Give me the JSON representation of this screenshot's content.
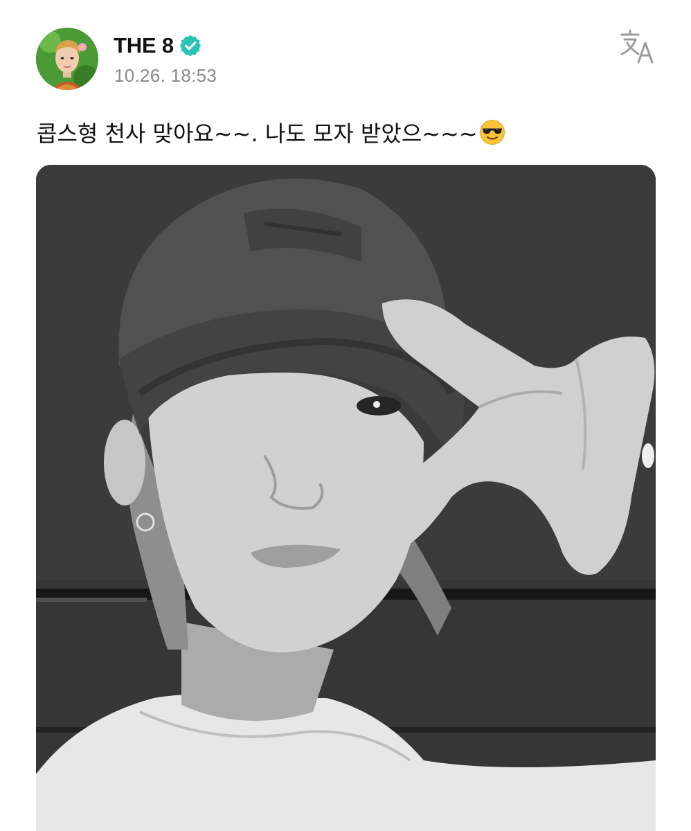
{
  "author": {
    "name": "THE 8",
    "verified": true,
    "avatar": "avatar-photo"
  },
  "post": {
    "timestamp": "10.26. 18:53",
    "text": "콥스형 천사 맞아요~~. 나도 모자 받았으~~~",
    "emoji": "smiling-face-with-sunglasses",
    "image": "black-and-white selfie photo"
  },
  "icons": {
    "translate": "translate-icon",
    "verified": "verified-badge-icon"
  },
  "colors": {
    "verified": "#2bc4b4",
    "timestamp": "#8a8a8a",
    "icon": "#9a9a9a",
    "text": "#111111"
  }
}
